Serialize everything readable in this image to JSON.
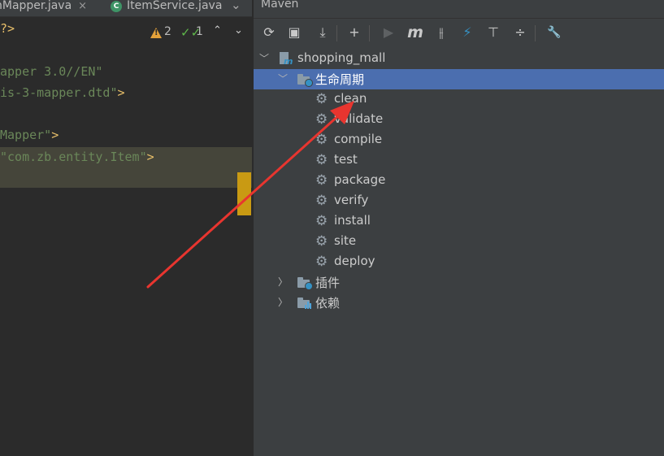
{
  "editor": {
    "tabs": [
      {
        "label": "nMapper.java",
        "close": "×"
      },
      {
        "label": "ItemService.java",
        "class_badge": "C",
        "close": "×"
      }
    ],
    "tab_overflow": "⌄",
    "inspections": {
      "warnings": "2",
      "weak_warnings": "1"
    },
    "code_lines": [
      {
        "parts": [
          {
            "t": "?>",
            "c": "tag"
          }
        ]
      },
      {
        "parts": [
          {
            "t": "apper 3.0//EN\"",
            "c": "str"
          }
        ]
      },
      {
        "parts": [
          {
            "t": "is-3-mapper.dtd\"",
            "c": "str"
          },
          {
            "t": ">",
            "c": "tag"
          }
        ]
      },
      {
        "parts": [
          {
            "t": "Mapper\"",
            "c": "str"
          },
          {
            "t": ">",
            "c": "tag"
          }
        ]
      },
      {
        "parts": [
          {
            "t": "\"com.zb.entity.Item\"",
            "c": "str"
          },
          {
            "t": ">",
            "c": "tag"
          }
        ]
      }
    ]
  },
  "maven": {
    "title": "Maven",
    "toolbar": [
      {
        "name": "reload-icon",
        "glyph": "⟳"
      },
      {
        "name": "generate-sources-icon",
        "glyph": "▣"
      },
      {
        "name": "download-icon",
        "glyph": "⤓"
      },
      {
        "name": "add-icon",
        "glyph": "+"
      },
      {
        "name": "run-icon",
        "glyph": "▶",
        "disabled": true
      },
      {
        "name": "execute-goal-icon",
        "glyph": "m"
      },
      {
        "name": "toggle-offline-icon",
        "glyph": "⫲"
      },
      {
        "name": "skip-tests-icon",
        "glyph": "⚡"
      },
      {
        "name": "show-dependencies-icon",
        "glyph": "⊤"
      },
      {
        "name": "collapse-all-icon",
        "glyph": "÷"
      },
      {
        "name": "settings-wrench-icon",
        "glyph": "🔧"
      }
    ],
    "project": "shopping_mall",
    "lifecycle": {
      "label": "生命周期",
      "goals": [
        "clean",
        "validate",
        "compile",
        "test",
        "package",
        "verify",
        "install",
        "site",
        "deploy"
      ]
    },
    "plugins_label": "插件",
    "dependencies_label": "依赖"
  },
  "colors": {
    "selection": "#4b6eaf",
    "annotation_arrow": "#e8352f",
    "change_marker": "#c99a13"
  }
}
